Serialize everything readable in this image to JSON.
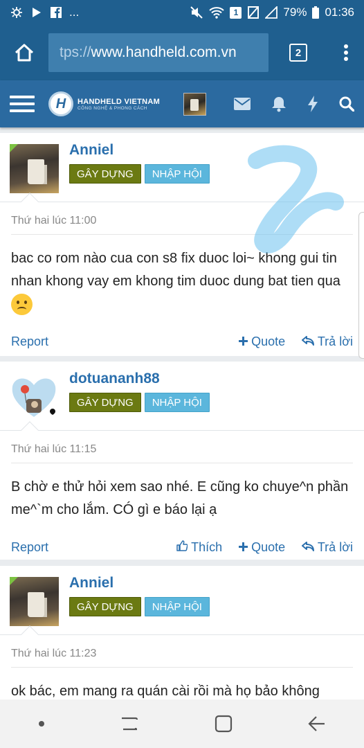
{
  "status_bar": {
    "left_glyphs": "...",
    "battery": "79%",
    "time": "01:36",
    "sim": "1"
  },
  "browser": {
    "url_scheme": "tps://",
    "url_host": "www.handheld.com.vn",
    "tab_count": "2"
  },
  "site": {
    "logo_name": "HANDHELD VIETNAM",
    "logo_tagline": "CÔNG NGHỆ & PHONG CÁCH"
  },
  "posts": [
    {
      "username": "Anniel",
      "badge1": "GÂY DỰNG",
      "badge2": "NHẬP HỘI",
      "time": "Thứ hai lúc 11:00",
      "message": "bac co rom nào cua con s8 fix duoc loi~ khong gui tin nhan khong vay em khong tim duoc dung bat tien qua",
      "report": "Report",
      "quote": "Quote",
      "reply": "Trả lời"
    },
    {
      "username": "dotuananh88",
      "badge1": "GÂY DỰNG",
      "badge2": "NHẬP HỘI",
      "time": "Thứ hai lúc 11:15",
      "message": "B chờ e thử hỏi xem sao nhé. E cũng ko chuye^n phần me^`m cho lắm. CÓ gì e báo lại ạ",
      "report": "Report",
      "like": "Thích",
      "quote": "Quote",
      "reply": "Trả lời"
    },
    {
      "username": "Anniel",
      "badge1": "GÂY DỰNG",
      "badge2": "NHẬP HỘI",
      "time": "Thứ hai lúc 11:23",
      "message": "ok bác, em mang ra quán cài rồi mà họ bảo không"
    }
  ],
  "colors": {
    "header": "#1f5f8f",
    "site_nav": "#2b6aa0",
    "link": "#2a6fad",
    "badge_build": "#6b7a12",
    "badge_join": "#5bb6dc"
  },
  "icons": [
    "home-icon",
    "tabs-icon",
    "overflow-menu-icon",
    "hamburger-icon",
    "mail-icon",
    "bell-icon",
    "lightning-icon",
    "search-icon",
    "plus-icon",
    "reply-icon",
    "thumbs-up-icon",
    "recents-icon",
    "home-nav-icon",
    "back-icon"
  ]
}
